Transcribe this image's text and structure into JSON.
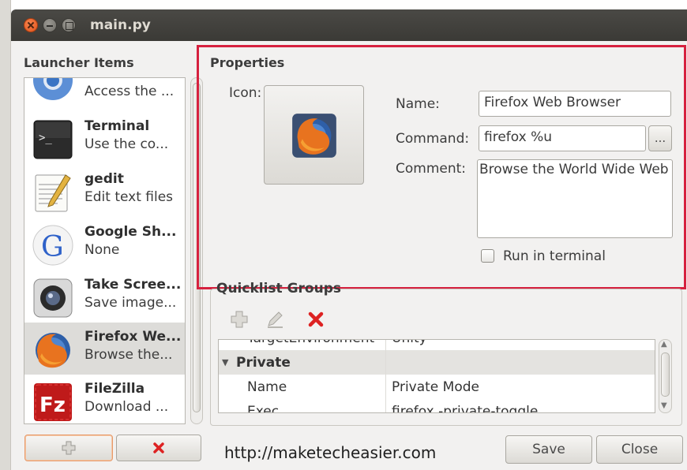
{
  "window": {
    "title": "main.py"
  },
  "launcher": {
    "section_label": "Launcher Items",
    "items": [
      {
        "name": "",
        "desc": "Access the ...",
        "icon": "chromium-icon"
      },
      {
        "name": "Terminal",
        "desc": "Use the co...",
        "icon": "terminal-icon"
      },
      {
        "name": "gedit",
        "desc": "Edit text files",
        "icon": "gedit-icon"
      },
      {
        "name": "Google Sh...",
        "desc": "None",
        "icon": "google-icon"
      },
      {
        "name": "Take Scree...",
        "desc": "Save image...",
        "icon": "screenshot-icon"
      },
      {
        "name": "Firefox We...",
        "desc": "Browse the...",
        "icon": "firefox-icon",
        "selected": true
      },
      {
        "name": "FileZilla",
        "desc": "Download ...",
        "icon": "filezilla-icon"
      }
    ]
  },
  "properties": {
    "section_label": "Properties",
    "icon_label": "Icon:",
    "name_label": "Name:",
    "name_value": "Firefox Web Browser",
    "command_label": "Command:",
    "command_value": "firefox %u",
    "browse_label": "...",
    "comment_label": "Comment:",
    "comment_value": "Browse the World Wide Web",
    "run_in_terminal_label": "Run in terminal",
    "run_in_terminal_checked": false
  },
  "quicklist": {
    "section_label": "Quicklist Groups",
    "rows": [
      {
        "key": "TargetEnvironment",
        "value": "Unity",
        "partial": true
      },
      {
        "key": "Private",
        "value": "",
        "group": true
      },
      {
        "key": "Name",
        "value": "Private Mode"
      },
      {
        "key": "Exec",
        "value": "firefox -private-toggle"
      }
    ]
  },
  "footer": {
    "url": "http://maketecheasier.com",
    "save_label": "Save",
    "close_label": "Close"
  },
  "colors": {
    "highlight": "#d6213f",
    "titlebar": "#3b3a36",
    "accent": "#e0531b"
  }
}
